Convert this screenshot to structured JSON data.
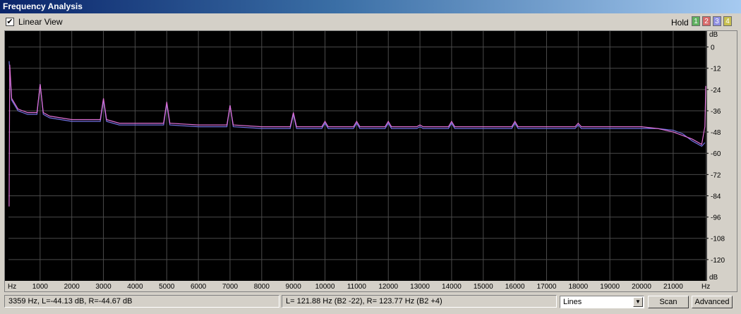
{
  "window": {
    "title": "Frequency Analysis"
  },
  "toolbar": {
    "linear_view_label": "Linear View",
    "linear_view_checked": true,
    "hold_label": "Hold",
    "hold_buttons": [
      {
        "label": "1",
        "color": "#5fb05f"
      },
      {
        "label": "2",
        "color": "#d86a6a"
      },
      {
        "label": "3",
        "color": "#8f8fe0"
      },
      {
        "label": "4",
        "color": "#c8c050"
      }
    ]
  },
  "status": {
    "cursor_readout": "3359 Hz, L=-44.13 dB, R=-44.67 dB",
    "pitch_readout": "L= 121.88 Hz (B2 -22), R= 123.77 Hz (B2 +4)",
    "view_mode": "Lines",
    "scan_label": "Scan",
    "advanced_label": "Advanced"
  },
  "chart_data": {
    "type": "line",
    "x_unit_label": "Hz",
    "y_unit_label": "dB",
    "x_tick_labels": [
      "1000",
      "2000",
      "3000",
      "4000",
      "5000",
      "6000",
      "7000",
      "8000",
      "9000",
      "10000",
      "11000",
      "12000",
      "13000",
      "14000",
      "15000",
      "16000",
      "17000",
      "18000",
      "19000",
      "20000",
      "21000"
    ],
    "y_tick_labels": [
      "0",
      "-12",
      "-24",
      "-36",
      "-48",
      "-60",
      "-72",
      "-84",
      "-96",
      "-108",
      "-120"
    ],
    "xlim": [
      0,
      22050
    ],
    "ylim": [
      -132,
      9
    ],
    "grid": true,
    "series": [
      {
        "color": "#7070e0",
        "x": [
          20,
          100,
          300,
          600,
          900,
          1000,
          1100,
          1300,
          2000,
          2900,
          3000,
          3100,
          3500,
          4900,
          5000,
          5100,
          6000,
          6900,
          7000,
          7100,
          8000,
          8900,
          9000,
          9100,
          9900,
          10000,
          10100,
          10900,
          11000,
          11100,
          11900,
          12000,
          12100,
          12900,
          13000,
          13100,
          13900,
          14000,
          14100,
          15000,
          15900,
          16000,
          16100,
          17000,
          17900,
          18000,
          18100,
          19000,
          20000,
          20500,
          21000,
          21300,
          21600,
          21900,
          22000
        ],
        "y": [
          -8,
          -30,
          -36,
          -38,
          -38,
          -21,
          -38,
          -40,
          -42,
          -42,
          -30,
          -42,
          -44,
          -44,
          -32,
          -44,
          -45,
          -45,
          -33,
          -45,
          -46,
          -46,
          -38,
          -46,
          -46,
          -43,
          -46,
          -46,
          -43,
          -46,
          -46,
          -43,
          -46,
          -46,
          -45,
          -46,
          -46,
          -43,
          -46,
          -46,
          -46,
          -43,
          -46,
          -46,
          -46,
          -44,
          -46,
          -46,
          -46,
          -46,
          -47,
          -49,
          -53,
          -56,
          -54
        ]
      },
      {
        "color": "#e070d8",
        "x": [
          20,
          40,
          100,
          300,
          600,
          900,
          1000,
          1100,
          1300,
          2000,
          2900,
          3000,
          3100,
          3500,
          4900,
          5000,
          5100,
          6000,
          6900,
          7000,
          7100,
          8000,
          8900,
          9000,
          9100,
          9900,
          10000,
          10100,
          10900,
          11000,
          11100,
          11900,
          12000,
          12100,
          12900,
          13000,
          13100,
          13900,
          14000,
          14100,
          15000,
          15900,
          16000,
          16100,
          17000,
          17900,
          18000,
          18100,
          19000,
          20000,
          20500,
          21000,
          21300,
          21600,
          21900,
          22000,
          22030
        ],
        "y": [
          -90,
          -10,
          -29,
          -35,
          -37,
          -37,
          -21,
          -37,
          -39,
          -41,
          -41,
          -29,
          -41,
          -43,
          -43,
          -31,
          -43,
          -44,
          -44,
          -33,
          -44,
          -45,
          -45,
          -37,
          -45,
          -45,
          -42,
          -45,
          -45,
          -42,
          -45,
          -45,
          -42,
          -45,
          -45,
          -44,
          -45,
          -45,
          -42,
          -45,
          -45,
          -45,
          -42,
          -45,
          -45,
          -45,
          -43,
          -45,
          -45,
          -45,
          -46,
          -48,
          -50,
          -52,
          -55,
          -45,
          -22
        ]
      }
    ]
  }
}
